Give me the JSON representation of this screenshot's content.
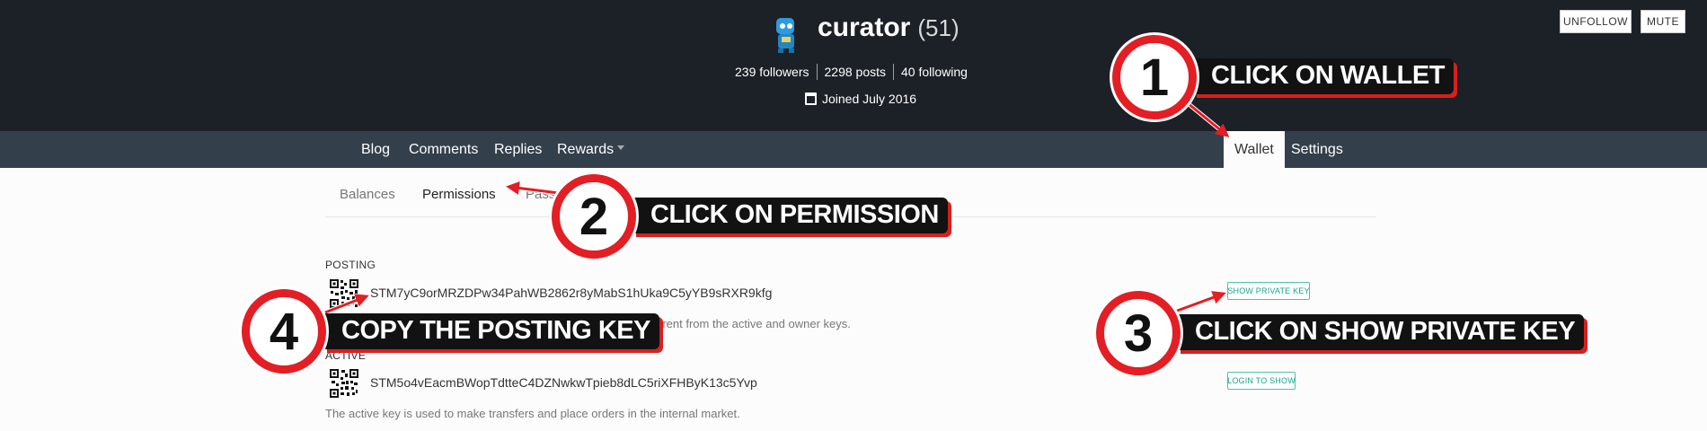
{
  "header": {
    "username": "curator",
    "reputation": "(51)",
    "followers": "239 followers",
    "posts": "2298 posts",
    "following": "40 following",
    "joined": "Joined July 2016",
    "unfollow_label": "UNFOLLOW",
    "mute_label": "MUTE"
  },
  "nav": {
    "blog": "Blog",
    "comments": "Comments",
    "replies": "Replies",
    "rewards": "Rewards",
    "wallet": "Wallet",
    "settings": "Settings"
  },
  "wallet_tabs": {
    "balances": "Balances",
    "permissions": "Permissions",
    "passwords": "Pass"
  },
  "keys": {
    "posting": {
      "label": "POSTING",
      "public_key": "STM7yC9orMRZDPw34PahWB2862r8yMabS1hUka9C5yYB9sRXR9kfg",
      "description_partial": "different from the active and owner keys.",
      "button": "SHOW PRIVATE KEY"
    },
    "active": {
      "label": "ACTIVE",
      "public_key": "STM5o4vEacmBWopTdtteC4DZNwkwTpieb8dLC5riXFHByK13c5Yvp",
      "description": "The active key is used to make transfers and place orders in the internal market.",
      "button": "LOGIN TO SHOW"
    }
  },
  "annotations": [
    {
      "number": "1",
      "text": "CLICK ON WALLET"
    },
    {
      "number": "2",
      "text": "CLICK ON PERMISSION"
    },
    {
      "number": "3",
      "text": "CLICK ON SHOW PRIVATE KEY"
    },
    {
      "number": "4",
      "text": "COPY THE POSTING KEY"
    }
  ],
  "colors": {
    "header_bg": "#1c2127",
    "nav_bg": "#343f4c",
    "accent_teal": "#1aa38a",
    "annotation_red": "#e31e24"
  }
}
